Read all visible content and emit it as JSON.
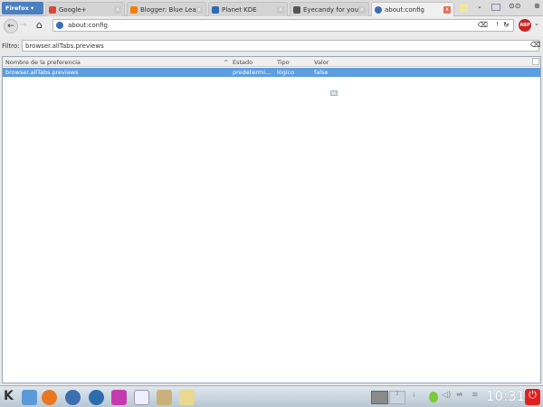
{
  "browser": {
    "menu_label": "Firefox",
    "tabs": [
      {
        "title": "Google+",
        "color": "#d34836"
      },
      {
        "title": "Blogger: Blue Lea...",
        "color": "#f57d00"
      },
      {
        "title": "Planet KDE",
        "color": "#2d6bb5"
      },
      {
        "title": "Eyecandy for your...",
        "color": "#555555"
      },
      {
        "title": "about:config",
        "color": "#3a6db5"
      }
    ],
    "url": "about:config"
  },
  "filter": {
    "label": "Filtro:",
    "value": "browser.allTabs.previews"
  },
  "table": {
    "columns": [
      "Nombre de la preferencia",
      "Estado",
      "Tipo",
      "Valor"
    ],
    "sort_indicator": "^",
    "rows": [
      {
        "name": "browser.allTabs.previews",
        "state": "predetermi...",
        "type": "lógico",
        "value": "false"
      }
    ]
  },
  "taskbar": {
    "pager": "2",
    "clock": "10:31"
  }
}
